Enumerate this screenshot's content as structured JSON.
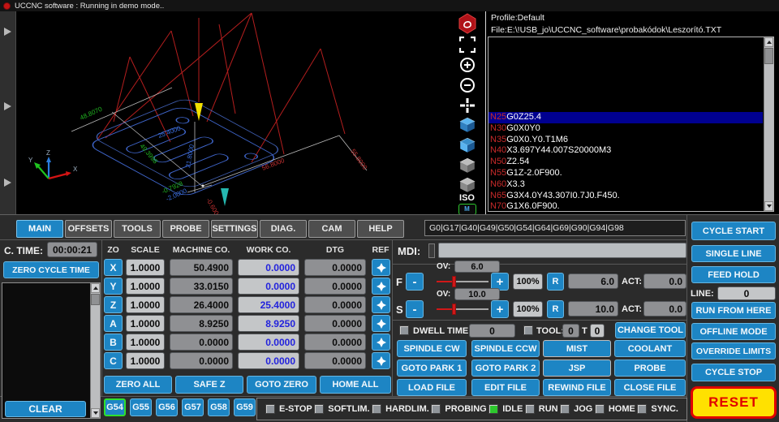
{
  "titlebar": {
    "title": "UCCNC software : Running in demo mode.."
  },
  "viewport": {
    "labels": [
      {
        "text": "48.8070",
        "color": "#21b421"
      },
      {
        "text": "49.3998",
        "color": "#21b421"
      },
      {
        "text": "25.4000",
        "color": "#3b6fe0"
      },
      {
        "text": "21.8000",
        "color": "#3b6fe0"
      },
      {
        "text": "-0.7928",
        "color": "#21b421"
      },
      {
        "text": "-2.0000",
        "color": "#3b6fe0"
      },
      {
        "text": "56.8000",
        "color": "#c03030"
      },
      {
        "text": "55.8000",
        "color": "#c03030"
      },
      {
        "text": "-0.6000",
        "color": "#c03030"
      }
    ],
    "axis": {
      "x": "X",
      "y": "Y",
      "z": "Z"
    }
  },
  "icon_column": {
    "iso": "ISO",
    "reload": "Reload"
  },
  "file_panel": {
    "profile": "Profile:Default",
    "file": "File:E:\\!USB_jo\\UCCNC_software\\probakódok\\Leszorító.TXT"
  },
  "gcode": {
    "selected_index": 0,
    "lines": [
      {
        "n": "N25",
        "code": "G0Z25.4"
      },
      {
        "n": "N30",
        "code": "G0X0Y0"
      },
      {
        "n": "N35",
        "code": "G0X0.Y0.T1M6"
      },
      {
        "n": "N40",
        "code": "X3.697Y44.007S20000M3"
      },
      {
        "n": "N50",
        "code": "Z2.54"
      },
      {
        "n": "N55",
        "code": "G1Z-2.0F900."
      },
      {
        "n": "N60",
        "code": "X3.3"
      },
      {
        "n": "N65",
        "code": "G3X4.0Y43.307I0.7J0.F450."
      },
      {
        "n": "N70",
        "code": "G1X6.0F900."
      }
    ]
  },
  "tabs": {
    "items": [
      "MAIN",
      "OFFSETS",
      "TOOLS",
      "PROBE",
      "SETTINGS",
      "DIAG.",
      "CAM",
      "HELP"
    ],
    "active": "MAIN"
  },
  "modal_codes": "G0|G17|G40|G49|G50|G54|G64|G69|G90|G94|G98",
  "cycle_time": {
    "label": "C. TIME:",
    "value": "00:00:21",
    "zero_button": "ZERO CYCLE TIME",
    "clear_button": "CLEAR"
  },
  "dro": {
    "headers": {
      "zo": "ZO",
      "scale": "SCALE",
      "machine": "MACHINE CO.",
      "work": "WORK CO.",
      "dtg": "DTG",
      "ref": "REF"
    },
    "rows": [
      {
        "axis": "X",
        "scale": "1.0000",
        "machine": "50.4900",
        "work": "0.0000",
        "dtg": "0.0000"
      },
      {
        "axis": "Y",
        "scale": "1.0000",
        "machine": "33.0150",
        "work": "0.0000",
        "dtg": "0.0000"
      },
      {
        "axis": "Z",
        "scale": "1.0000",
        "machine": "26.4000",
        "work": "25.4000",
        "dtg": "0.0000"
      },
      {
        "axis": "A",
        "scale": "1.0000",
        "machine": "8.9250",
        "work": "8.9250",
        "dtg": "0.0000"
      },
      {
        "axis": "B",
        "scale": "1.0000",
        "machine": "0.0000",
        "work": "0.0000",
        "dtg": "0.0000"
      },
      {
        "axis": "C",
        "scale": "1.0000",
        "machine": "0.0000",
        "work": "0.0000",
        "dtg": "0.0000"
      }
    ],
    "buttons": [
      "ZERO ALL",
      "SAFE Z",
      "GOTO ZERO",
      "HOME ALL"
    ]
  },
  "wcs": {
    "buttons": [
      "G54",
      "G55",
      "G56",
      "G57",
      "G58",
      "G59"
    ],
    "active": "G54"
  },
  "mdi": {
    "label": "MDI:"
  },
  "overrides": {
    "feed": {
      "axis": "F",
      "ov_label": "OV:",
      "ov": "6.0",
      "minus": "-",
      "plus": "+",
      "percent": "100%",
      "reset": "R",
      "value": "6.0",
      "act_label": "ACT:",
      "act": "0.0"
    },
    "spindle": {
      "axis": "S",
      "ov_label": "OV:",
      "ov": "10.0",
      "minus": "-",
      "plus": "+",
      "percent": "100%",
      "reset": "R",
      "value": "10.0",
      "act_label": "ACT:",
      "act": "0.0"
    }
  },
  "tool_row": {
    "dwell_label": "DWELL TIME:",
    "dwell_value": "0",
    "tool_label": "TOOL:",
    "tool_value": "0",
    "t_label": "T",
    "t_value": "0",
    "change_tool": "CHANGE TOOL"
  },
  "action_buttons": {
    "row1": [
      "SPINDLE CW",
      "SPINDLE CCW",
      "MIST",
      "COOLANT"
    ],
    "row2": [
      "GOTO PARK 1",
      "GOTO PARK 2",
      "JSP",
      "PROBE"
    ],
    "row3": [
      "LOAD FILE",
      "EDIT FILE",
      "REWIND FILE",
      "CLOSE FILE"
    ]
  },
  "right_column": {
    "cycle_start": "CYCLE START",
    "single_line": "SINGLE LINE",
    "feed_hold": "FEED HOLD",
    "line_label": "LINE:",
    "line_value": "0",
    "run_from_here": "RUN FROM HERE",
    "offline_mode": "OFFLINE MODE",
    "override_limits": "OVERRIDE LIMITS",
    "cycle_stop": "CYCLE STOP",
    "reset": "RESET"
  },
  "status_leds": [
    {
      "label": "E-STOP",
      "on": false
    },
    {
      "label": "SOFTLIM.",
      "on": false
    },
    {
      "label": "HARDLIM.",
      "on": false
    },
    {
      "label": "PROBING",
      "on": false
    },
    {
      "label": "IDLE",
      "on": true
    },
    {
      "label": "RUN",
      "on": false
    },
    {
      "label": "JOG",
      "on": false
    },
    {
      "label": "HOME",
      "on": false
    },
    {
      "label": "SYNC.",
      "on": false
    }
  ],
  "colors": {
    "accent_blue": "#1d85c4",
    "led_on": "#2dc82d",
    "reset_bg": "#ffe100",
    "reset_border": "#e00000",
    "work_text": "#2222dd",
    "gcode_lineno": "#c82a2a",
    "gcode_highlight": "#000090",
    "wcs_active_border": "#2ee02e"
  }
}
